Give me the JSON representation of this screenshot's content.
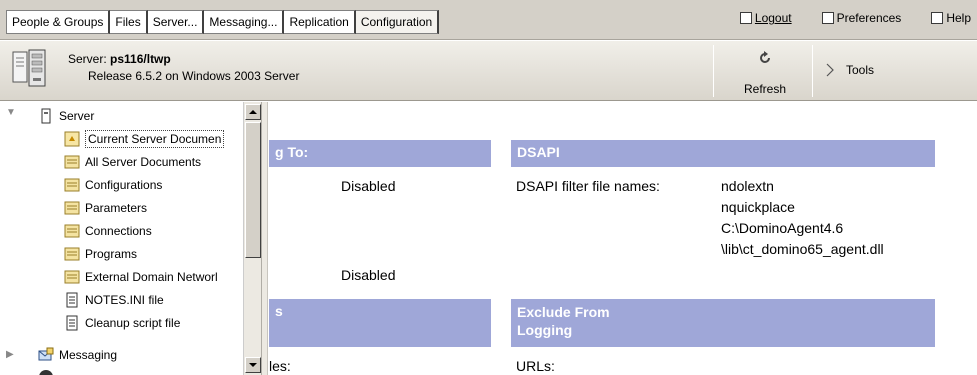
{
  "tabs": [
    {
      "label": "People & Groups"
    },
    {
      "label": "Files"
    },
    {
      "label": "Server..."
    },
    {
      "label": "Messaging..."
    },
    {
      "label": "Replication"
    },
    {
      "label": "Configuration"
    }
  ],
  "top_links": {
    "logout": "Logout",
    "preferences": "Preferences",
    "help": "Help"
  },
  "server": {
    "prefix": "Server:",
    "name": "ps116/ltwp",
    "release": "Release 6.5.2 on Windows 2003 Server"
  },
  "toolbar": {
    "refresh": "Refresh",
    "tools": "Tools"
  },
  "tree": {
    "root": "Server",
    "items": [
      {
        "label": "Current Server Documen",
        "icon": "document-view-icon"
      },
      {
        "label": "All Server Documents",
        "icon": "view-icon"
      },
      {
        "label": "Configurations",
        "icon": "view-icon"
      },
      {
        "label": "Parameters",
        "icon": "view-icon"
      },
      {
        "label": "Connections",
        "icon": "view-icon"
      },
      {
        "label": "Programs",
        "icon": "view-icon"
      },
      {
        "label": "External Domain Networl",
        "icon": "view-icon"
      },
      {
        "label": "NOTES.INI file",
        "icon": "text-file-icon"
      },
      {
        "label": "Cleanup script file",
        "icon": "text-file-icon"
      }
    ],
    "messaging": "Messaging"
  },
  "content": {
    "left_section_head": "g To:",
    "value_disabled_1": "Disabled",
    "value_disabled_2": "Disabled",
    "left_section_head_2": "s",
    "partial_label": "les:",
    "dsapi": {
      "head": "DSAPI",
      "label": "DSAPI filter file names:",
      "values": [
        "ndolextn",
        "nquickplace",
        "C:\\DominoAgent4.6",
        "\\lib\\ct_domino65_agent.dll"
      ]
    },
    "exclude": {
      "head_line1": "Exclude From",
      "head_line2": "Logging",
      "urls_label": "URLs:"
    }
  },
  "colors": {
    "section_head_bg": "#9fa7d8",
    "toolbar_bg": "#d4d0c8"
  }
}
